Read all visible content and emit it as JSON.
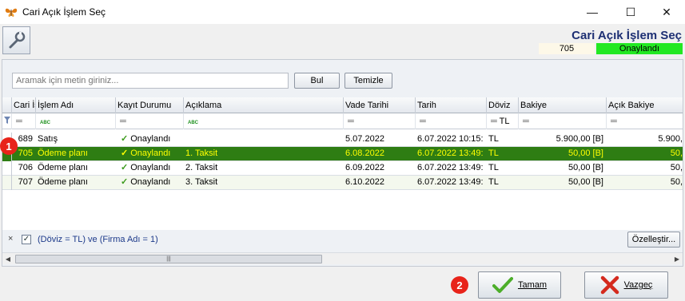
{
  "window": {
    "title": "Cari Açık İşlem Seç",
    "minimize": "—",
    "maximize": "☐",
    "close": "✕"
  },
  "header": {
    "title": "Cari Açık İşlem Seç",
    "record_id": "705",
    "status": "Onaylandı",
    "status_color": "#22e822"
  },
  "search": {
    "placeholder": "Aramak için metin giriniz...",
    "find_label": "Bul",
    "clear_label": "Temizle"
  },
  "grid": {
    "columns": [
      "Cari İş",
      "İşlem Adı",
      "Kayıt Durumu",
      "Açıklama",
      "Vade Tarihi",
      "Tarih",
      "Döviz",
      "Bakiye",
      "Açık Bakiye"
    ],
    "filter_currency": "TL",
    "rows": [
      {
        "id": "689",
        "name": "Satış",
        "status": "Onaylandı",
        "desc": "",
        "due": "5.07.2022",
        "date": "6.07.2022 10:15:",
        "currency": "TL",
        "balance": "5.900,00 [B]",
        "open_balance": "5.900,",
        "selected": false
      },
      {
        "id": "705",
        "name": "Ödeme planı",
        "status": "Onaylandı",
        "desc": "1. Taksit",
        "due": "6.08.2022",
        "date": "6.07.2022 13:49:",
        "currency": "TL",
        "balance": "50,00 [B]",
        "open_balance": "50,",
        "selected": true
      },
      {
        "id": "706",
        "name": "Ödeme planı",
        "status": "Onaylandı",
        "desc": "2. Taksit",
        "due": "6.09.2022",
        "date": "6.07.2022 13:49:",
        "currency": "TL",
        "balance": "50,00 [B]",
        "open_balance": "50,",
        "selected": false
      },
      {
        "id": "707",
        "name": "Ödeme planı",
        "status": "Onaylandı",
        "desc": "3. Taksit",
        "due": "6.10.2022",
        "date": "6.07.2022 13:49:",
        "currency": "TL",
        "balance": "50,00 [B]",
        "open_balance": "50,",
        "selected": false
      }
    ],
    "selected_row_color": "#2e7d13",
    "selected_text_color": "#ffff00"
  },
  "filter_bar": {
    "close": "×",
    "checked": "✓",
    "expression": "(Döviz = TL) ve (Firma Adı = 1)",
    "customize_label": "Özelleştir..."
  },
  "buttons": {
    "ok_label": "Tamam",
    "cancel_label": "Vazgeç"
  },
  "annotations": {
    "badge1": "1",
    "badge2": "2"
  }
}
